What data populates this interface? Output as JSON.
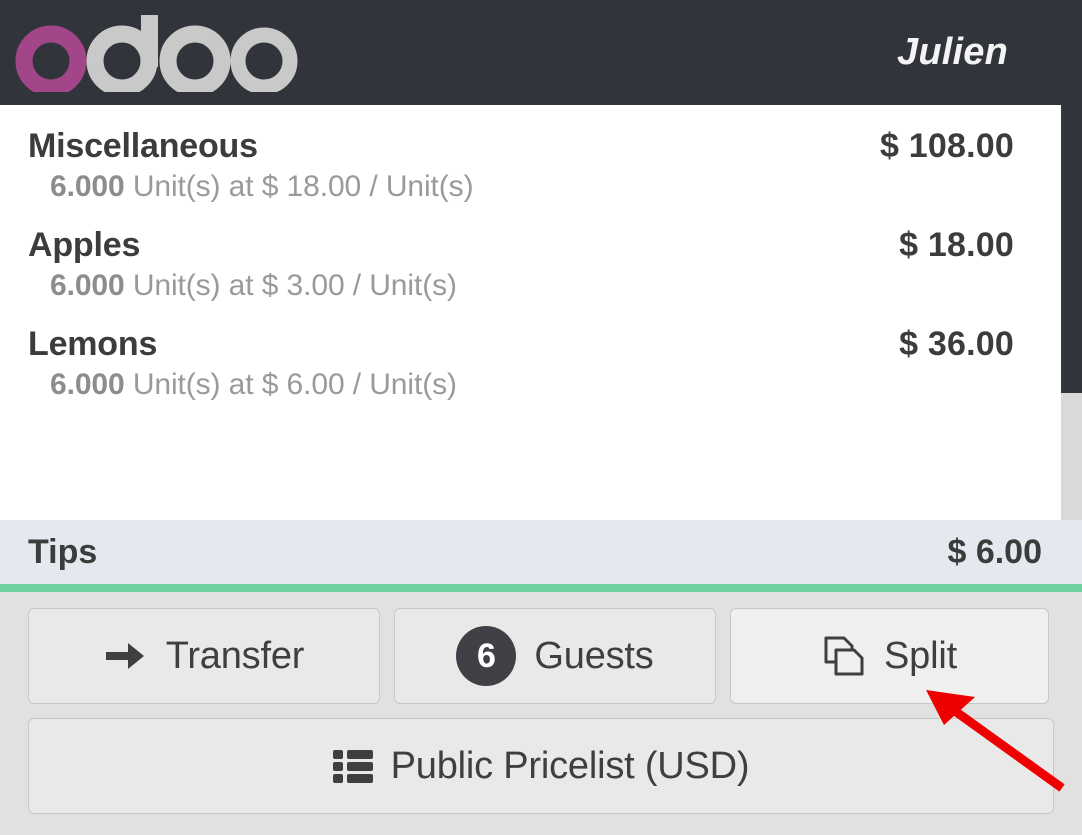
{
  "header": {
    "logo_name": "odoo",
    "logo_accent_color": "#a24689",
    "logo_gray_color": "#c9c9c9",
    "background_color": "#31353b",
    "username": "Julien"
  },
  "order": {
    "lines": [
      {
        "name": "Miscellaneous",
        "price": "$ 108.00",
        "qty": "6.000",
        "detail": " Unit(s) at $ 18.00 / Unit(s)"
      },
      {
        "name": "Apples",
        "price": "$ 18.00",
        "qty": "6.000",
        "detail": " Unit(s) at $ 3.00 / Unit(s)"
      },
      {
        "name": "Lemons",
        "price": "$ 36.00",
        "qty": "6.000",
        "detail": " Unit(s) at $ 6.00 / Unit(s)"
      }
    ],
    "scrollbar": {
      "thumb_color": "#32353b",
      "track_color": "#d9d9d9"
    }
  },
  "summary": {
    "tips_label": "Tips",
    "tips_value": "$ 6.00",
    "row_background": "#e4e9f0",
    "divider_color": "#6ecf9f"
  },
  "actions": {
    "transfer": {
      "label": "Transfer",
      "icon": "arrow-right-icon"
    },
    "guests": {
      "label": "Guests",
      "count": "6",
      "icon": "guest-count-badge"
    },
    "split": {
      "label": "Split",
      "icon": "split-copy-icon"
    },
    "pricelist": {
      "label": "Public Pricelist (USD)",
      "icon": "list-icon"
    }
  },
  "annotation": {
    "type": "arrow",
    "color": "#ef0000",
    "points_at": "split-button"
  }
}
